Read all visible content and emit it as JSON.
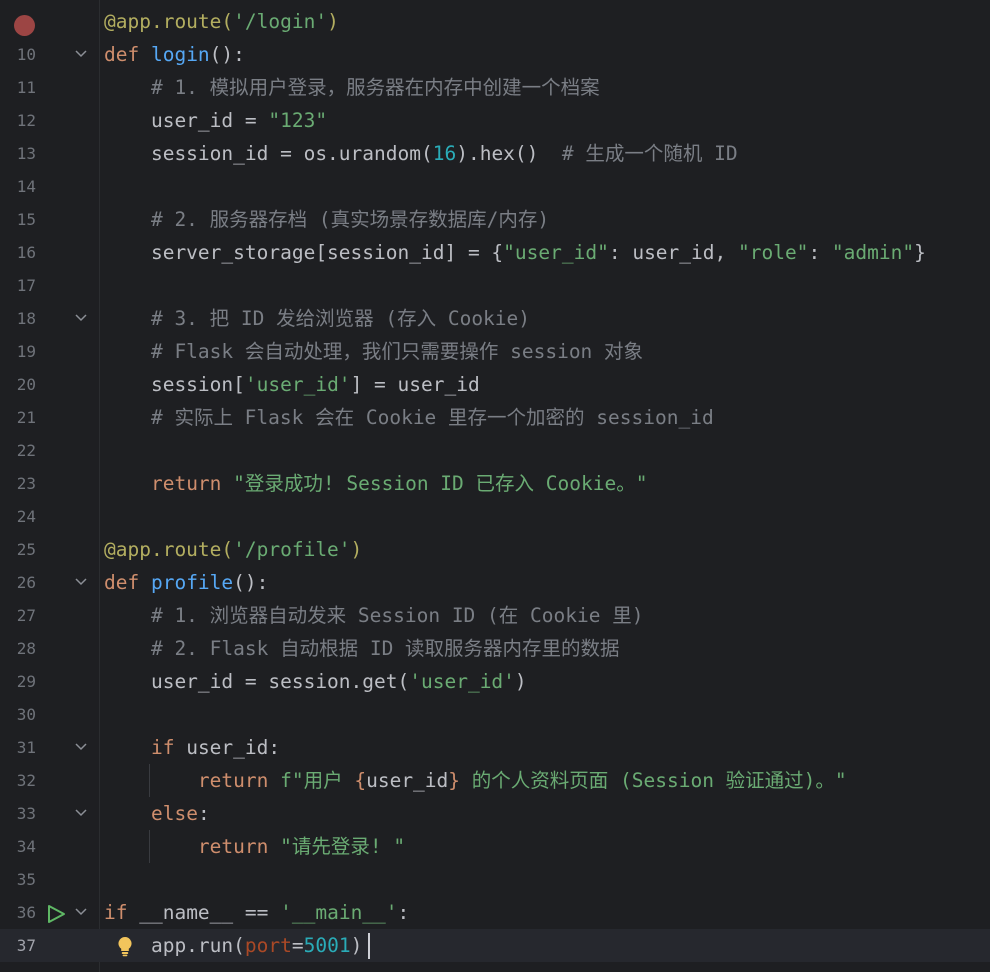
{
  "editor": {
    "lines": [
      {
        "no": "",
        "tokens": [
          {
            "t": "@app.route(",
            "c": "dec"
          },
          {
            "t": "'/login'",
            "c": "str"
          },
          {
            "t": ")",
            "c": "dec"
          }
        ]
      },
      {
        "no": "10",
        "tokens": [
          {
            "t": "def ",
            "c": "kw"
          },
          {
            "t": "login",
            "c": "fn"
          },
          {
            "t": "():",
            "c": ""
          }
        ]
      },
      {
        "no": "11",
        "tokens": [
          {
            "t": "    # 1. 模拟用户登录，服务器在内存中创建一个档案",
            "c": "cm"
          }
        ]
      },
      {
        "no": "12",
        "tokens": [
          {
            "t": "    user_id = ",
            "c": ""
          },
          {
            "t": "\"123\"",
            "c": "str"
          }
        ]
      },
      {
        "no": "13",
        "tokens": [
          {
            "t": "    session_id = os.urandom(",
            "c": ""
          },
          {
            "t": "16",
            "c": "num"
          },
          {
            "t": ").hex()  ",
            "c": ""
          },
          {
            "t": "# 生成一个随机 ID",
            "c": "cm"
          }
        ]
      },
      {
        "no": "14",
        "tokens": []
      },
      {
        "no": "15",
        "tokens": [
          {
            "t": "    # 2. 服务器存档 (真实场景存数据库/内存)",
            "c": "cm"
          }
        ]
      },
      {
        "no": "16",
        "tokens": [
          {
            "t": "    server_storage[session_id] = {",
            "c": ""
          },
          {
            "t": "\"user_id\"",
            "c": "str"
          },
          {
            "t": ": user_id, ",
            "c": ""
          },
          {
            "t": "\"role\"",
            "c": "str"
          },
          {
            "t": ": ",
            "c": ""
          },
          {
            "t": "\"admin\"",
            "c": "str"
          },
          {
            "t": "}",
            "c": ""
          }
        ]
      },
      {
        "no": "17",
        "tokens": []
      },
      {
        "no": "18",
        "tokens": [
          {
            "t": "    # 3. 把 ID 发给浏览器 (存入 Cookie)",
            "c": "cm"
          }
        ]
      },
      {
        "no": "19",
        "tokens": [
          {
            "t": "    # Flask 会自动处理，我们只需要操作 session 对象",
            "c": "cm"
          }
        ]
      },
      {
        "no": "20",
        "tokens": [
          {
            "t": "    session[",
            "c": ""
          },
          {
            "t": "'user_id'",
            "c": "str"
          },
          {
            "t": "] = user_id",
            "c": ""
          }
        ]
      },
      {
        "no": "21",
        "tokens": [
          {
            "t": "    # 实际上 Flask 会在 Cookie 里存一个加密的 session_id",
            "c": "cm"
          }
        ]
      },
      {
        "no": "22",
        "tokens": []
      },
      {
        "no": "23",
        "tokens": [
          {
            "t": "    ",
            "c": ""
          },
          {
            "t": "return ",
            "c": "kw"
          },
          {
            "t": "\"登录成功! Session ID 已存入 Cookie。\"",
            "c": "str"
          }
        ]
      },
      {
        "no": "24",
        "tokens": []
      },
      {
        "no": "25",
        "tokens": [
          {
            "t": "@app.route(",
            "c": "dec"
          },
          {
            "t": "'/profile'",
            "c": "str"
          },
          {
            "t": ")",
            "c": "dec"
          }
        ]
      },
      {
        "no": "26",
        "tokens": [
          {
            "t": "def ",
            "c": "kw"
          },
          {
            "t": "profile",
            "c": "fn"
          },
          {
            "t": "():",
            "c": ""
          }
        ]
      },
      {
        "no": "27",
        "tokens": [
          {
            "t": "    # 1. 浏览器自动发来 Session ID (在 Cookie 里)",
            "c": "cm"
          }
        ]
      },
      {
        "no": "28",
        "tokens": [
          {
            "t": "    # 2. Flask 自动根据 ID 读取服务器内存里的数据",
            "c": "cm"
          }
        ]
      },
      {
        "no": "29",
        "tokens": [
          {
            "t": "    user_id = session.get(",
            "c": ""
          },
          {
            "t": "'user_id'",
            "c": "str"
          },
          {
            "t": ")",
            "c": ""
          }
        ]
      },
      {
        "no": "30",
        "tokens": []
      },
      {
        "no": "31",
        "tokens": [
          {
            "t": "    ",
            "c": ""
          },
          {
            "t": "if ",
            "c": "kw"
          },
          {
            "t": "user_id:",
            "c": ""
          }
        ]
      },
      {
        "no": "32",
        "tokens": [
          {
            "t": "        ",
            "c": ""
          },
          {
            "t": "return ",
            "c": "kw"
          },
          {
            "t": "f\"用户 ",
            "c": "str"
          },
          {
            "t": "{",
            "c": "brc"
          },
          {
            "t": "user_id",
            "c": ""
          },
          {
            "t": "}",
            "c": "brc"
          },
          {
            "t": " 的个人资料页面 (Session 验证通过)。\"",
            "c": "str"
          }
        ]
      },
      {
        "no": "33",
        "tokens": [
          {
            "t": "    ",
            "c": ""
          },
          {
            "t": "else",
            "c": "kw"
          },
          {
            "t": ":",
            "c": ""
          }
        ]
      },
      {
        "no": "34",
        "tokens": [
          {
            "t": "        ",
            "c": ""
          },
          {
            "t": "return ",
            "c": "kw"
          },
          {
            "t": "\"请先登录! \"",
            "c": "str"
          }
        ]
      },
      {
        "no": "35",
        "tokens": []
      },
      {
        "no": "36",
        "tokens": [
          {
            "t": "if ",
            "c": "kw"
          },
          {
            "t": "__name__ == ",
            "c": ""
          },
          {
            "t": "'__main__'",
            "c": "str"
          },
          {
            "t": ":",
            "c": ""
          }
        ]
      },
      {
        "no": "37",
        "tokens": [
          {
            "t": "    app.run(",
            "c": ""
          },
          {
            "t": "port",
            "c": "prm"
          },
          {
            "t": "=",
            "c": ""
          },
          {
            "t": "5001",
            "c": "num"
          },
          {
            "t": ")",
            "c": ""
          }
        ]
      }
    ],
    "fold_lines": [
      "10",
      "18",
      "26",
      "31",
      "33",
      "36"
    ],
    "guide_lines": [
      "32",
      "34"
    ],
    "current_line": "37",
    "breakpoint_line_index": 0,
    "run_line": "36",
    "intention_bulb_line": "37",
    "colors": {
      "background": "#1e1f22",
      "keyword": "#cf8e6d",
      "decorator": "#b3ae60",
      "function": "#56a8f5",
      "string": "#6aab73",
      "number": "#2aacb8",
      "comment": "#7a7e85",
      "parameter": "#aa4926",
      "breakpoint": "#b34c4a",
      "run_icon": "#5fb865",
      "bulb": "#f2c55c"
    },
    "icons": {
      "breakpoint": "breakpoint-icon",
      "run": "run-gutter-icon",
      "fold": "fold-chevron-icon",
      "bulb": "intention-bulb-icon"
    }
  }
}
